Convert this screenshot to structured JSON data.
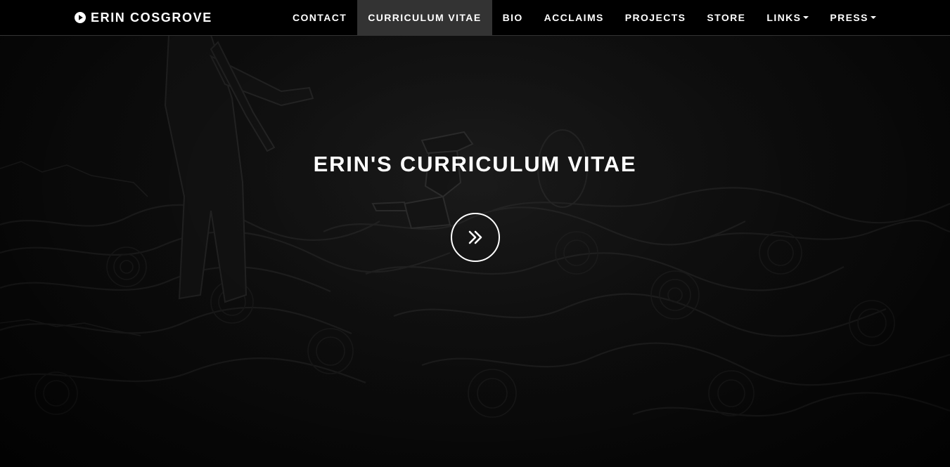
{
  "brand": {
    "icon": "play-circle-icon",
    "name": "ERIN COSGROVE"
  },
  "nav": {
    "items": [
      {
        "label": "CONTACT",
        "active": false,
        "dropdown": false
      },
      {
        "label": "CURRICULUM VITAE",
        "active": true,
        "dropdown": false
      },
      {
        "label": "BIO",
        "active": false,
        "dropdown": false
      },
      {
        "label": "ACCLAIMS",
        "active": false,
        "dropdown": false
      },
      {
        "label": "PROJECTS",
        "active": false,
        "dropdown": false
      },
      {
        "label": "STORE",
        "active": false,
        "dropdown": false
      },
      {
        "label": "LINKS",
        "active": false,
        "dropdown": true
      },
      {
        "label": "PRESS",
        "active": false,
        "dropdown": true
      }
    ]
  },
  "hero": {
    "title": "ERIN'S CURRICULUM VITAE",
    "scroll_icon": "double-chevron-right-icon"
  },
  "colors": {
    "navbar_bg": "#000000",
    "active_tab_bg": "#333333",
    "text": "#ffffff",
    "hero_bg": "#111111"
  }
}
